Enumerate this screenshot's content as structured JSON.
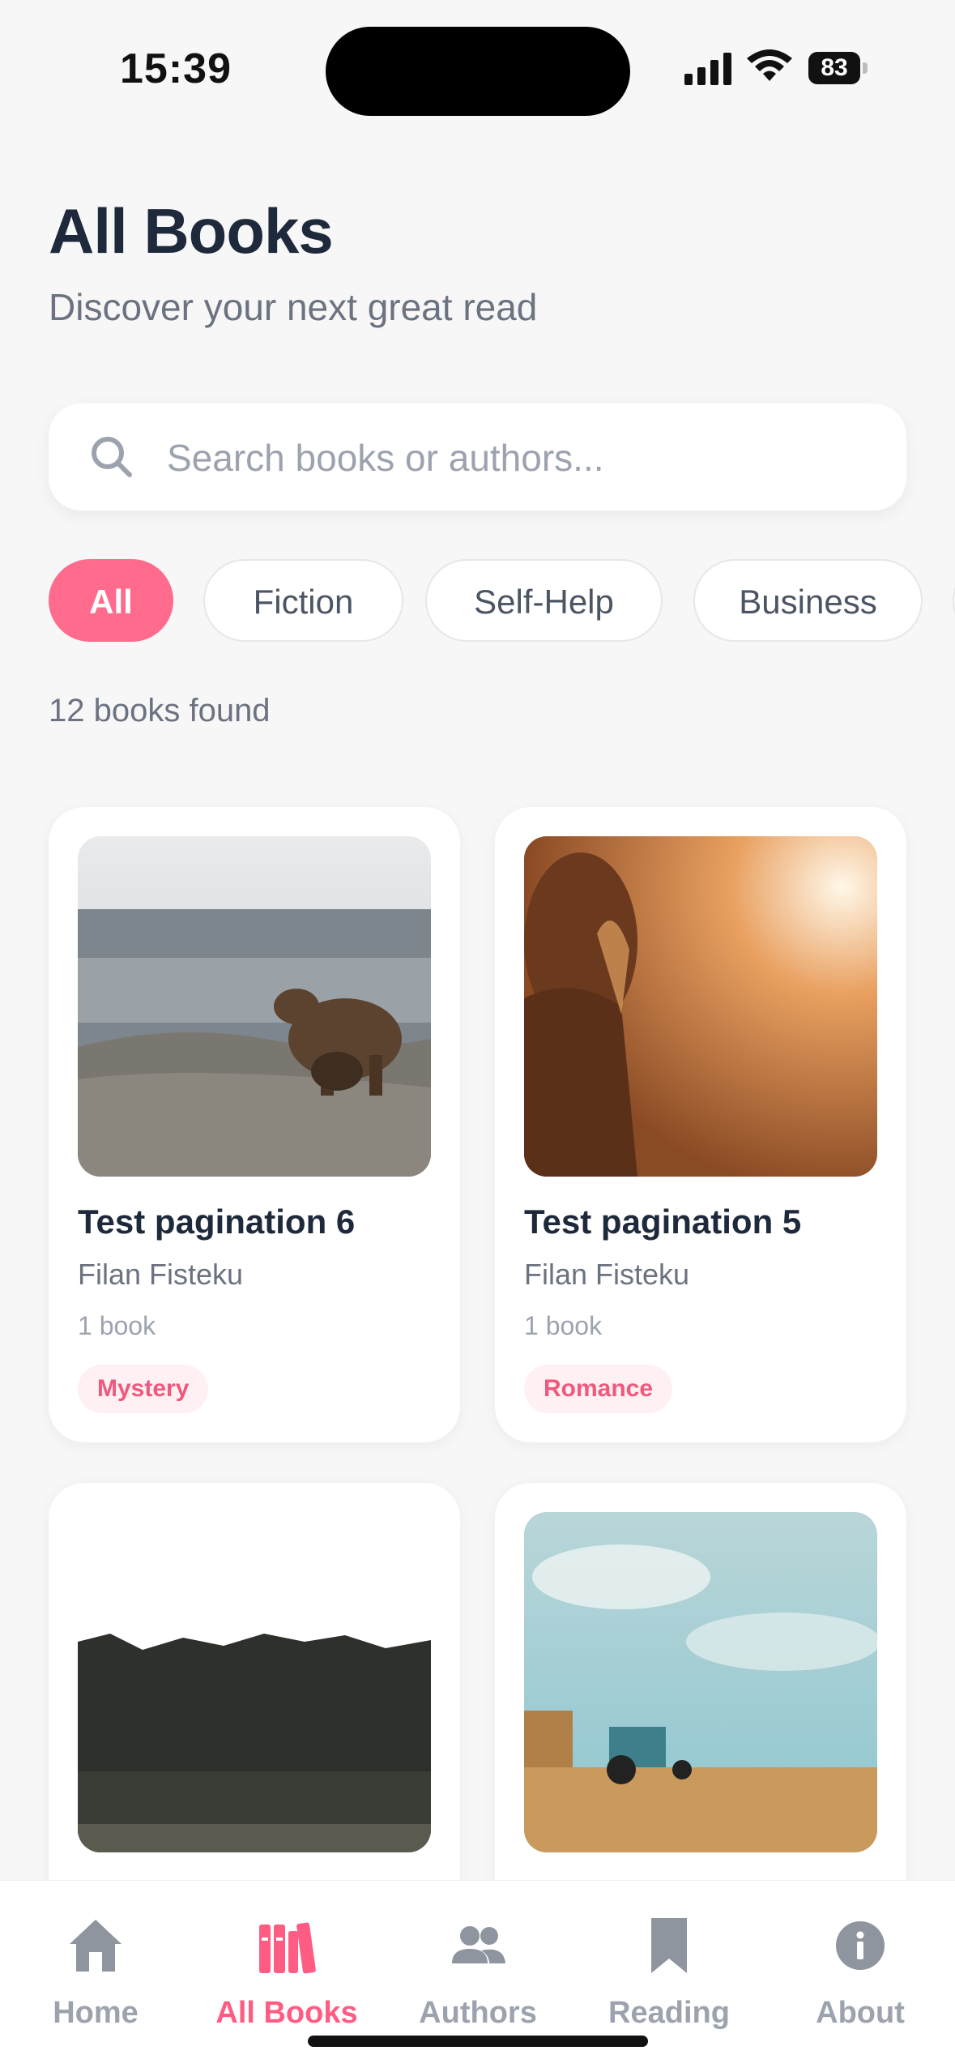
{
  "status_bar": {
    "time": "15:39",
    "battery": "83"
  },
  "header": {
    "title": "All Books",
    "subtitle": "Discover your next great read"
  },
  "search": {
    "placeholder": "Search books or authors..."
  },
  "filters": [
    {
      "label": "All",
      "active": true
    },
    {
      "label": "Fiction",
      "active": false
    },
    {
      "label": "Self-Help",
      "active": false
    },
    {
      "label": "Business",
      "active": false
    }
  ],
  "results": {
    "count_text": "12 books found"
  },
  "books": [
    {
      "title": "Test pagination 6",
      "author": "Filan Fisteku",
      "count": "1 book",
      "genre": "Mystery"
    },
    {
      "title": "Test pagination 5",
      "author": "Filan Fisteku",
      "count": "1 book",
      "genre": "Romance"
    },
    {
      "title": "",
      "author": "",
      "count": "",
      "genre": ""
    },
    {
      "title": "",
      "author": "",
      "count": "",
      "genre": ""
    }
  ],
  "tabbar": {
    "items": [
      {
        "label": "Home",
        "icon": "home-icon",
        "active": false
      },
      {
        "label": "All Books",
        "icon": "books-icon",
        "active": true
      },
      {
        "label": "Authors",
        "icon": "users-icon",
        "active": false
      },
      {
        "label": "Reading",
        "icon": "bookmark-icon",
        "active": false
      },
      {
        "label": "About",
        "icon": "info-icon",
        "active": false
      }
    ]
  },
  "colors": {
    "accent": "#ff6b8d",
    "genre_bg": "#fff0f3",
    "genre_text": "#f0587c",
    "title": "#1e2a3b",
    "muted": "#6b7280"
  }
}
